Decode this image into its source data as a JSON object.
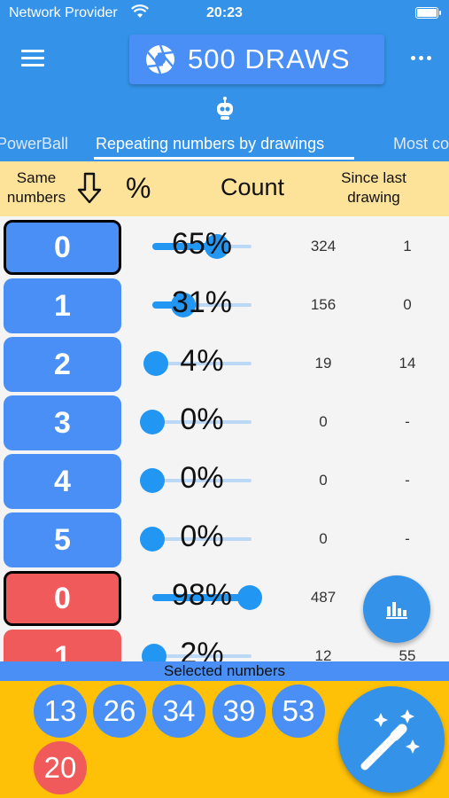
{
  "status_bar": {
    "carrier": "Network Provider",
    "time": "20:23"
  },
  "app_bar": {
    "title": "500 DRAWS"
  },
  "tabs": [
    {
      "label": "PowerBall",
      "active": false
    },
    {
      "label": "Repeating numbers by drawings",
      "active": true
    },
    {
      "label": "Most common",
      "active": false
    }
  ],
  "table_header": {
    "same_numbers": "Same numbers",
    "percent": "%",
    "count": "Count",
    "since_last": "Since last drawing"
  },
  "rows": [
    {
      "number": "0",
      "color": "blue",
      "selected": true,
      "percent_label": "65%",
      "percent_value": 65,
      "count": "324",
      "since": "1"
    },
    {
      "number": "1",
      "color": "blue",
      "selected": false,
      "percent_label": "31%",
      "percent_value": 31,
      "count": "156",
      "since": "0"
    },
    {
      "number": "2",
      "color": "blue",
      "selected": false,
      "percent_label": "4%",
      "percent_value": 4,
      "count": "19",
      "since": "14"
    },
    {
      "number": "3",
      "color": "blue",
      "selected": false,
      "percent_label": "0%",
      "percent_value": 0,
      "count": "0",
      "since": "-"
    },
    {
      "number": "4",
      "color": "blue",
      "selected": false,
      "percent_label": "0%",
      "percent_value": 0,
      "count": "0",
      "since": "-"
    },
    {
      "number": "5",
      "color": "blue",
      "selected": false,
      "percent_label": "0%",
      "percent_value": 0,
      "count": "0",
      "since": "-"
    },
    {
      "number": "0",
      "color": "red",
      "selected": true,
      "percent_label": "98%",
      "percent_value": 98,
      "count": "487",
      "since": ""
    },
    {
      "number": "1",
      "color": "red",
      "selected": false,
      "percent_label": "2%",
      "percent_value": 2,
      "count": "12",
      "since": "55"
    }
  ],
  "selected_bar": {
    "label": "Selected numbers"
  },
  "selected_numbers": [
    {
      "value": "13",
      "color": "blue"
    },
    {
      "value": "26",
      "color": "blue"
    },
    {
      "value": "34",
      "color": "blue"
    },
    {
      "value": "39",
      "color": "blue"
    },
    {
      "value": "53",
      "color": "blue"
    },
    {
      "value": "20",
      "color": "red"
    }
  ],
  "colors": {
    "primary": "#3493e8",
    "ball_blue": "#4a8ff5",
    "ball_red": "#f05a5a",
    "header_bg": "#fde29a",
    "bottom_bg": "#ffc107"
  },
  "icons": {
    "menu": "hamburger-icon",
    "title": "aperture-icon",
    "more": "more-dots-icon",
    "tab_header": "robot-icon",
    "sort": "arrow-down-icon",
    "chart_fab": "bar-chart-icon",
    "generate_fab": "magic-wand-icon"
  }
}
